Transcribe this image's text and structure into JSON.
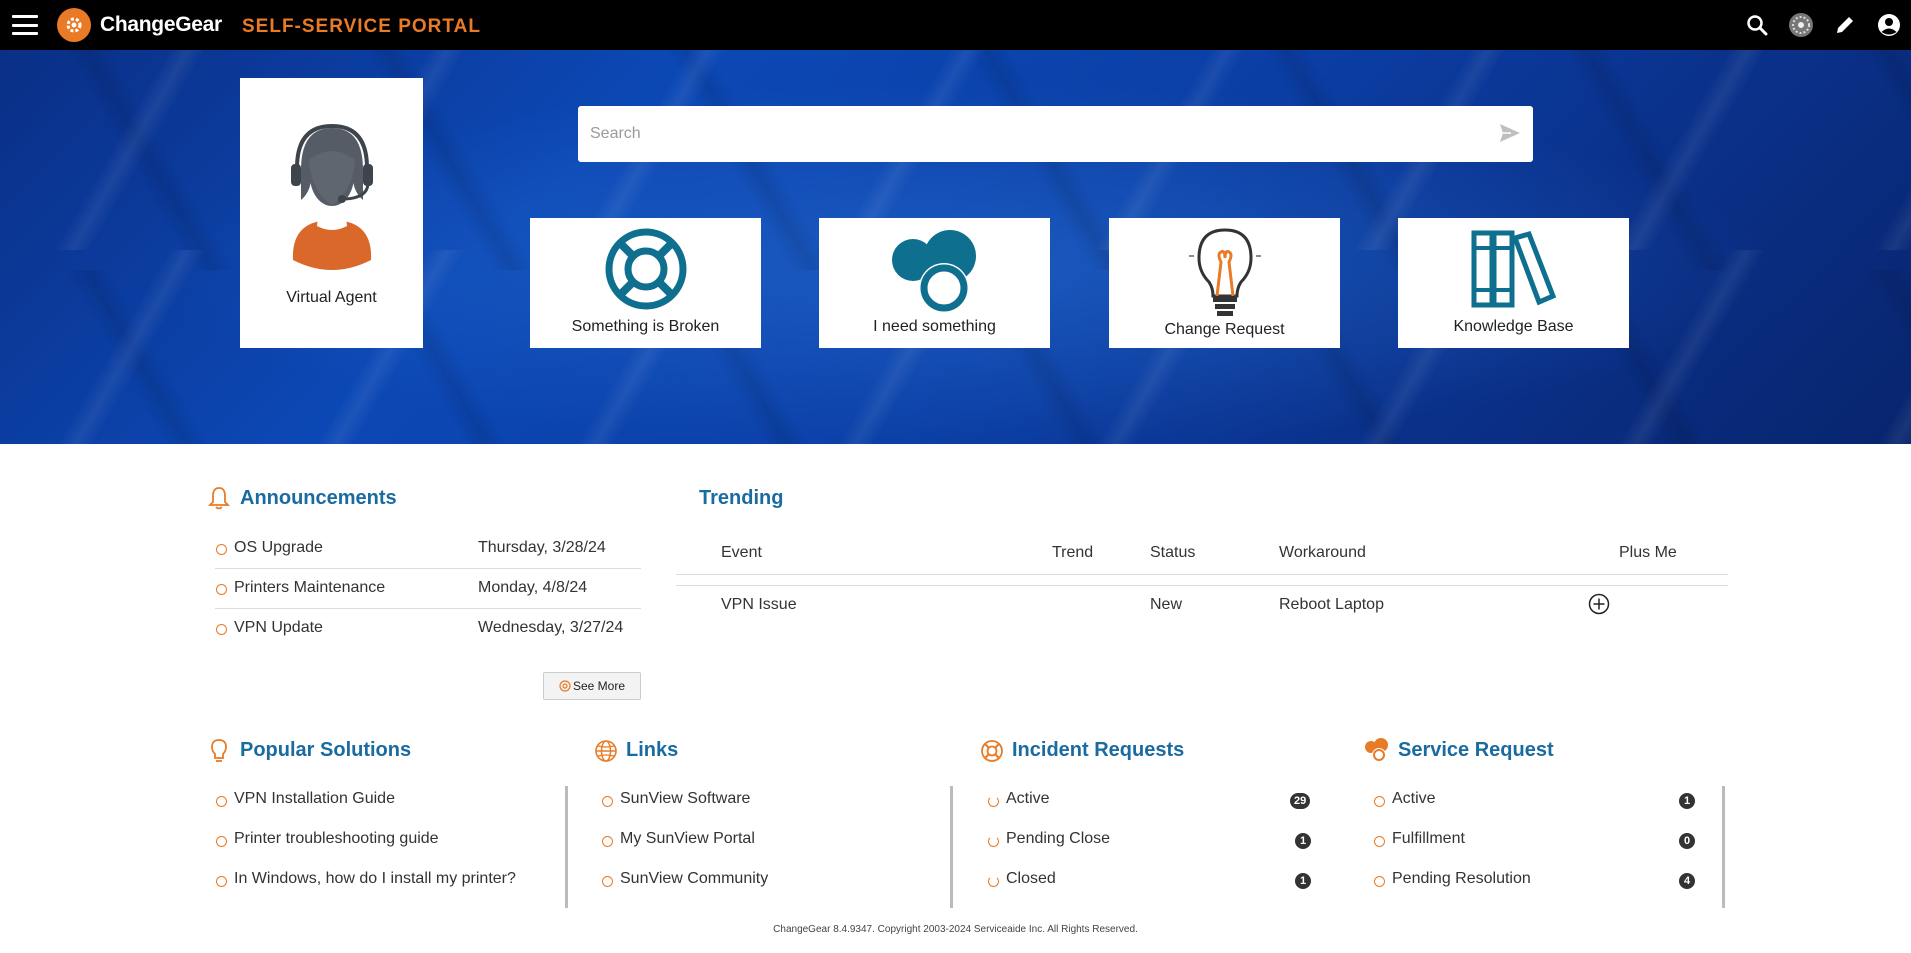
{
  "header": {
    "brand": "ChangeGear",
    "portal_title": "SELF-SERVICE PORTAL",
    "icons": [
      "menu-icon",
      "gear-icon",
      "search-icon",
      "avatar-icon",
      "edit-icon",
      "user-icon"
    ]
  },
  "hero": {
    "virtual_agent_label": "Virtual Agent",
    "search_placeholder": "Search",
    "search_value": "",
    "tiles": [
      {
        "label": "Something is Broken",
        "icon": "lifebuoy-icon"
      },
      {
        "label": "I need something",
        "icon": "bubbles-icon"
      },
      {
        "label": "Change Request",
        "icon": "lightbulb-icon"
      },
      {
        "label": "Knowledge Base",
        "icon": "books-icon"
      }
    ]
  },
  "announcements": {
    "title": "Announcements",
    "items": [
      {
        "text": "OS Upgrade",
        "date": "Thursday, 3/28/24"
      },
      {
        "text": "Printers Maintenance",
        "date": "Monday, 4/8/24"
      },
      {
        "text": "VPN Update",
        "date": "Wednesday, 3/27/24"
      }
    ],
    "see_more": "See More"
  },
  "trending": {
    "title": "Trending",
    "headers": [
      "Event",
      "Trend",
      "Status",
      "Workaround",
      "Plus Me"
    ],
    "rows": [
      {
        "event": "VPN Issue",
        "trend": "",
        "status": "New",
        "workaround": "Reboot Laptop"
      }
    ]
  },
  "popular_solutions": {
    "title": "Popular Solutions",
    "items": [
      "VPN Installation Guide",
      "Printer troubleshooting guide",
      "In Windows, how do I install my printer?"
    ]
  },
  "links": {
    "title": "Links",
    "items": [
      "SunView Software",
      "My SunView Portal",
      "SunView Community"
    ]
  },
  "incident_requests": {
    "title": "Incident Requests",
    "items": [
      {
        "label": "Active",
        "count": "29"
      },
      {
        "label": "Pending Close",
        "count": "1"
      },
      {
        "label": "Closed",
        "count": "1"
      }
    ]
  },
  "service_request": {
    "title": "Service Request",
    "items": [
      {
        "label": "Active",
        "count": "1"
      },
      {
        "label": "Fulfillment",
        "count": "0"
      },
      {
        "label": "Pending Resolution",
        "count": "4"
      }
    ]
  },
  "footer": {
    "text": "ChangeGear 8.4.9347. Copyright 2003-2024 Serviceaide Inc. All Rights Reserved."
  },
  "colors": {
    "accent": "#e97a26",
    "title_blue": "#1a6ba0",
    "icon_teal": "#0e6f8e"
  }
}
